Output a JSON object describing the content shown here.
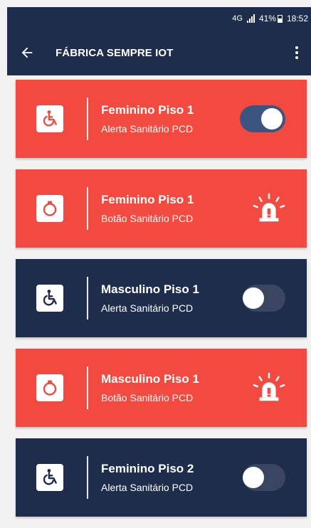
{
  "status_bar": {
    "network": "4G",
    "battery": "41%",
    "time": "18:52"
  },
  "app_bar": {
    "title": "FÁBRICA SEMPRE IOT",
    "back_icon": "arrow-left-icon",
    "menu_icon": "more-vert-icon"
  },
  "colors": {
    "red": "#f24a40",
    "navy": "#1f2d4c",
    "toggle_on": "#3b5580"
  },
  "cards": [
    {
      "title": "Feminino Piso 1",
      "subtitle": "Alerta Sanitário PCD",
      "icon": "wheelchair-icon",
      "theme": "red",
      "action": "toggle",
      "toggle_on": true
    },
    {
      "title": "Feminino Piso 1",
      "subtitle": "Botão Sanitário PCD",
      "icon": "panic-button-icon",
      "theme": "red",
      "action": "siren",
      "action_icon": "siren-icon"
    },
    {
      "title": "Masculino Piso 1",
      "subtitle": "Alerta Sanitário PCD",
      "icon": "wheelchair-icon",
      "theme": "navy",
      "action": "toggle",
      "toggle_on": false
    },
    {
      "title": "Masculino Piso 1",
      "subtitle": "Botão Sanitário PCD",
      "icon": "panic-button-icon",
      "theme": "red",
      "action": "siren",
      "action_icon": "siren-icon"
    },
    {
      "title": "Feminino Piso 2",
      "subtitle": "Alerta Sanitário PCD",
      "icon": "wheelchair-icon",
      "theme": "navy",
      "action": "toggle",
      "toggle_on": false
    }
  ]
}
